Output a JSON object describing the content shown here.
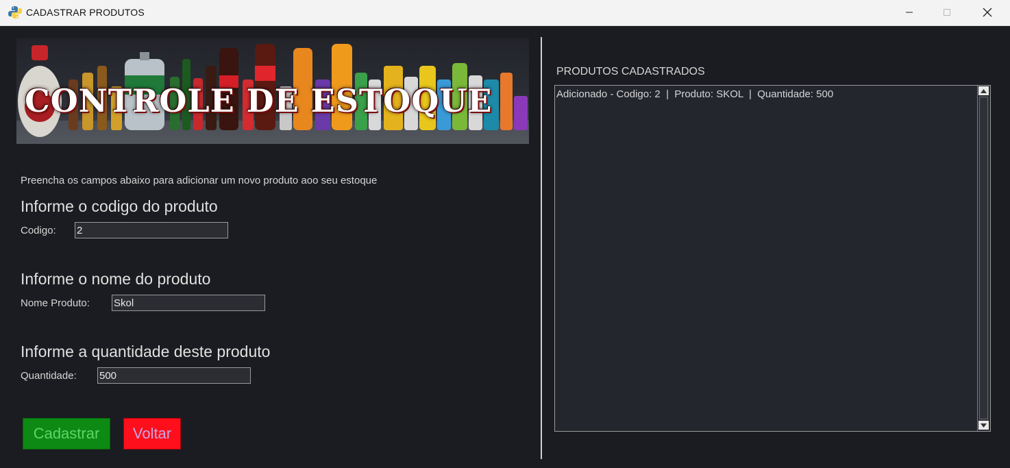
{
  "window": {
    "title": "CADASTRAR PRODUTOS"
  },
  "banner": {
    "title": "CONTROLE DE ESTOQUE"
  },
  "form": {
    "instructions": "Preencha os campos abaixo para adicionar um novo produto aoo seu estoque",
    "codigo": {
      "heading": "Informe o codigo do produto",
      "label": "Codigo:",
      "value": "2"
    },
    "nome": {
      "heading": "Informe o nome do produto",
      "label": "Nome Produto:",
      "value": "Skol"
    },
    "quantidade": {
      "heading": "Informe a quantidade deste produto",
      "label": "Quantidade:",
      "value": "500"
    },
    "buttons": {
      "cadastrar": "Cadastrar",
      "voltar": "Voltar"
    }
  },
  "list": {
    "title": "PRODUTOS CADASTRADOS",
    "items": [
      "Adicionado - Codigo: 2  |  Produto: SKOL  |  Quantidade: 500"
    ]
  },
  "colors": {
    "background": "#1b1c21",
    "cadastrar_bg": "#0c8a13",
    "voltar_bg": "#ff0f1b"
  }
}
